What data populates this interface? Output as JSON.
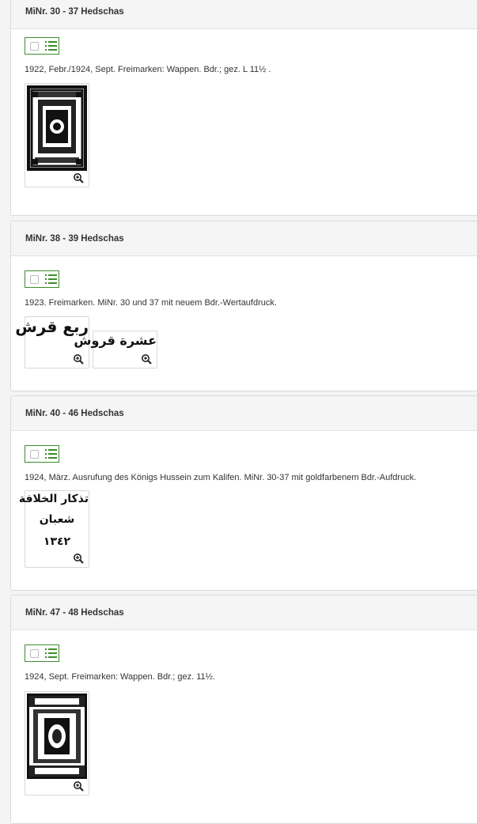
{
  "sections": [
    {
      "title": "MiNr. 30 - 37 Hedschas",
      "description": "1922, Febr./1924, Sept. Freimarken: Wappen. Bdr.; gez. L 11½ .",
      "thumbs": [
        {
          "kind": "stamp"
        }
      ]
    },
    {
      "title": "MiNr. 38 - 39 Hedschas",
      "description": "1923. Freimarken. MiNr. 30 und 37 mit neuem Bdr.-Wertaufdruck.",
      "thumbs": [
        {
          "kind": "overprint",
          "lines": [
            "ربع قرش"
          ]
        },
        {
          "kind": "overprint",
          "lines": [
            "عشرة قروش"
          ]
        }
      ]
    },
    {
      "title": "MiNr. 40 - 46 Hedschas",
      "description": "1924, März. Ausrufung des Königs Hussein zum Kalifen. MiNr. 30-37 mit goldfarbenem Bdr.-Aufdruck.",
      "thumbs": [
        {
          "kind": "overprint",
          "lines": [
            "تذكار الخلافة",
            "شعبان",
            "١٣٤٢"
          ]
        }
      ]
    },
    {
      "title": "MiNr. 47 - 48 Hedschas",
      "description": "1924, Sept. Freimarken: Wappen. Bdr.; gez. 11½.",
      "thumbs": [
        {
          "kind": "stamp"
        }
      ]
    }
  ],
  "colors": {
    "accent": "#3c8c2c",
    "header_bg": "#f5f5f5",
    "border": "#dadada"
  },
  "icons": {
    "select": "checkbox-icon",
    "list": "list-icon",
    "zoom": "zoom-in-icon"
  }
}
